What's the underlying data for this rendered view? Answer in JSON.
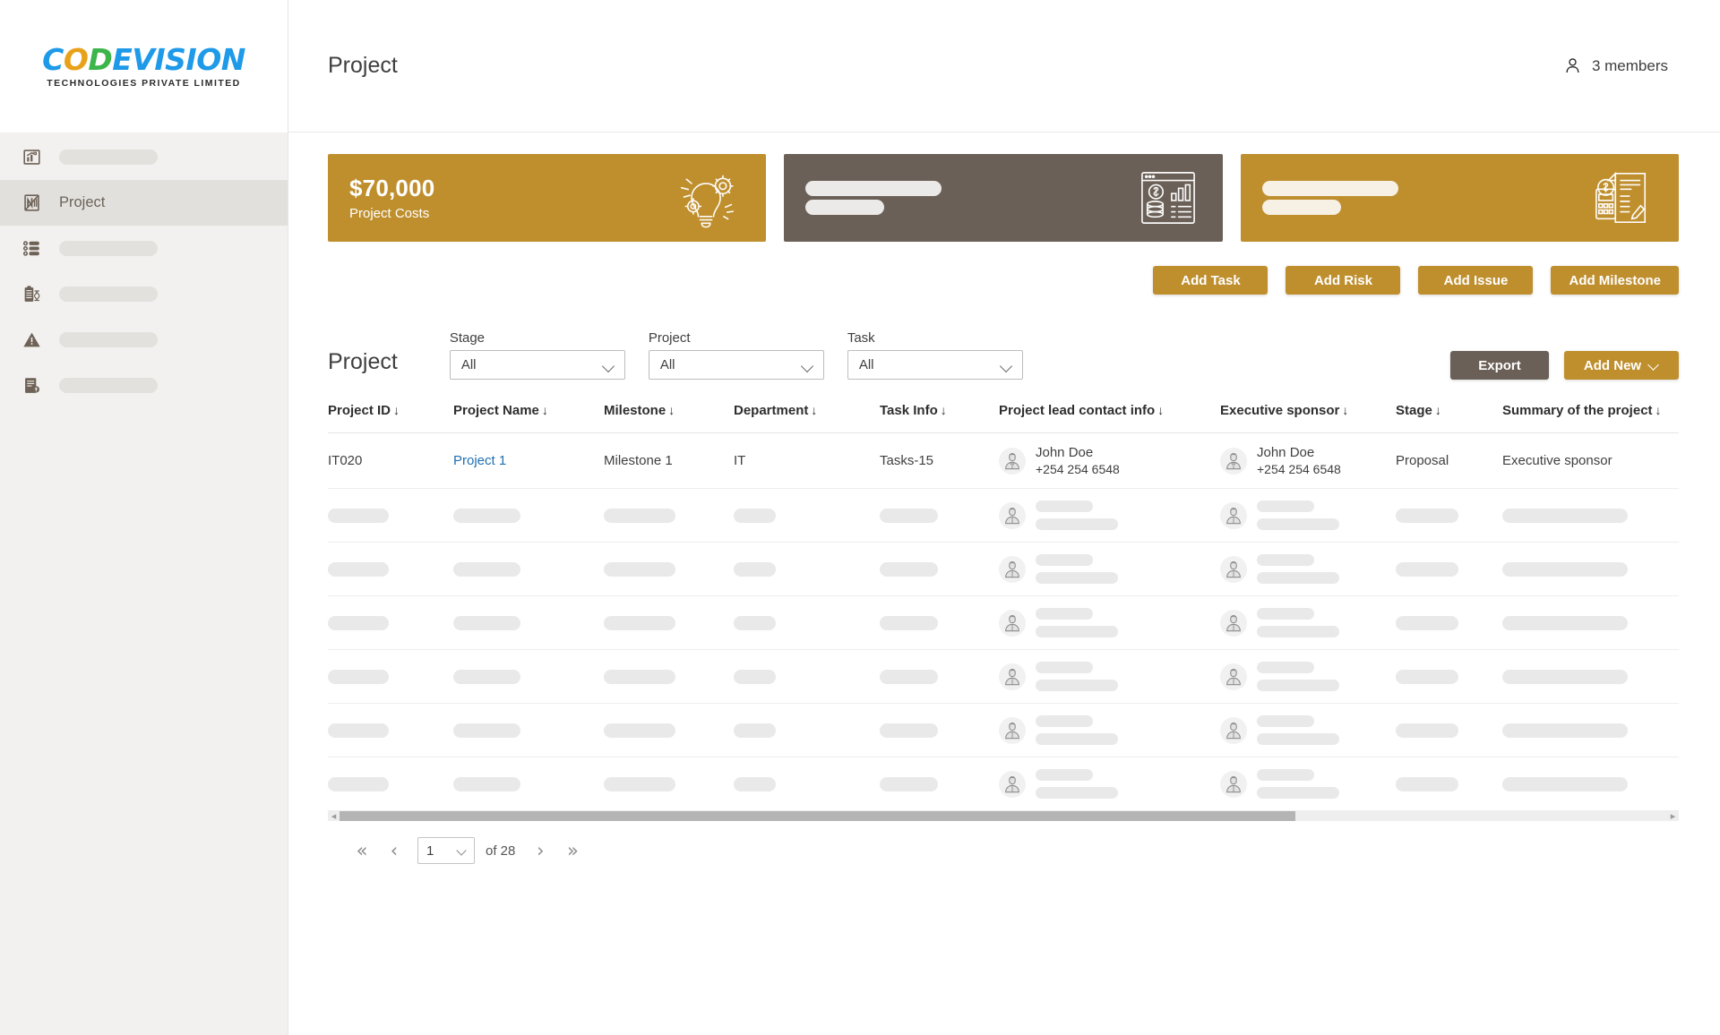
{
  "brand": {
    "logo_part1": "C",
    "logo_part2": "O",
    "logo_part3": "D",
    "logo_rest": "EVISION",
    "logo_full": "CODEVISION",
    "tagline": "TECHNOLOGIES PRIVATE LIMITED"
  },
  "sidebar": {
    "items": [
      {
        "label": "",
        "icon": "analytics-icon",
        "active": false,
        "skeleton": true
      },
      {
        "label": "Project",
        "icon": "project-document-icon",
        "active": true,
        "skeleton": false
      },
      {
        "label": "",
        "icon": "list-database-icon",
        "active": false,
        "skeleton": true
      },
      {
        "label": "",
        "icon": "clipboard-icon",
        "active": false,
        "skeleton": true
      },
      {
        "label": "",
        "icon": "warning-triangle-icon",
        "active": false,
        "skeleton": true
      },
      {
        "label": "",
        "icon": "report-document-icon",
        "active": false,
        "skeleton": true
      }
    ]
  },
  "header": {
    "title": "Project",
    "members_label": "3 members",
    "members_icon": "user-icon"
  },
  "cards": [
    {
      "value": "$70,000",
      "label": "Project Costs",
      "color": "#bf8f2e",
      "theme": "gold",
      "icon": "lightbulb-gears-icon",
      "skeleton": false
    },
    {
      "value": "",
      "label": "",
      "color": "#6b6057",
      "theme": "brown",
      "icon": "finance-dashboard-icon",
      "skeleton": true
    },
    {
      "value": "",
      "label": "",
      "color": "#bf8f2e",
      "theme": "gold",
      "icon": "calculator-invoice-icon",
      "skeleton": true
    }
  ],
  "actions": [
    {
      "label": "Add Task"
    },
    {
      "label": "Add Risk"
    },
    {
      "label": "Add Issue"
    },
    {
      "label": "Add Milestone"
    }
  ],
  "toolbar": {
    "section_title": "Project",
    "filters": [
      {
        "label": "Stage",
        "value": "All"
      },
      {
        "label": "Project",
        "value": "All"
      },
      {
        "label": "Task",
        "value": "All"
      }
    ],
    "export_label": "Export",
    "add_new_label": "Add New"
  },
  "table": {
    "sort_arrow": "↓",
    "columns": [
      "Project ID",
      "Project Name",
      "Milestone",
      "Department",
      "Task Info",
      "Project lead contact info",
      "Executive sponsor",
      "Stage",
      "Summary of the project"
    ],
    "rows": [
      {
        "project_id": "IT020",
        "project_name": "Project 1",
        "milestone": "Milestone 1",
        "department": "IT",
        "task_info": "Tasks-15",
        "project_lead": {
          "name": "John Doe",
          "phone": "+254 254 6548",
          "avatar": "person-avatar-icon"
        },
        "executive_sponsor": {
          "name": "John Doe",
          "phone": "+254 254 6548",
          "avatar": "person-avatar-icon"
        },
        "stage": "Proposal",
        "summary": "Executive sponsor"
      }
    ],
    "skeleton_row_count": 7
  },
  "pagination": {
    "first_label": "«",
    "prev_label": "‹",
    "current_page": "1",
    "of_label": "of 28",
    "next_label": "›",
    "last_label": "»"
  },
  "colors": {
    "gold": "#bf8f2e",
    "brown": "#6b6057",
    "link": "#1f6fb2",
    "sidebar_bg": "#f2f1ef",
    "sidebar_active": "#e2e0dd"
  }
}
